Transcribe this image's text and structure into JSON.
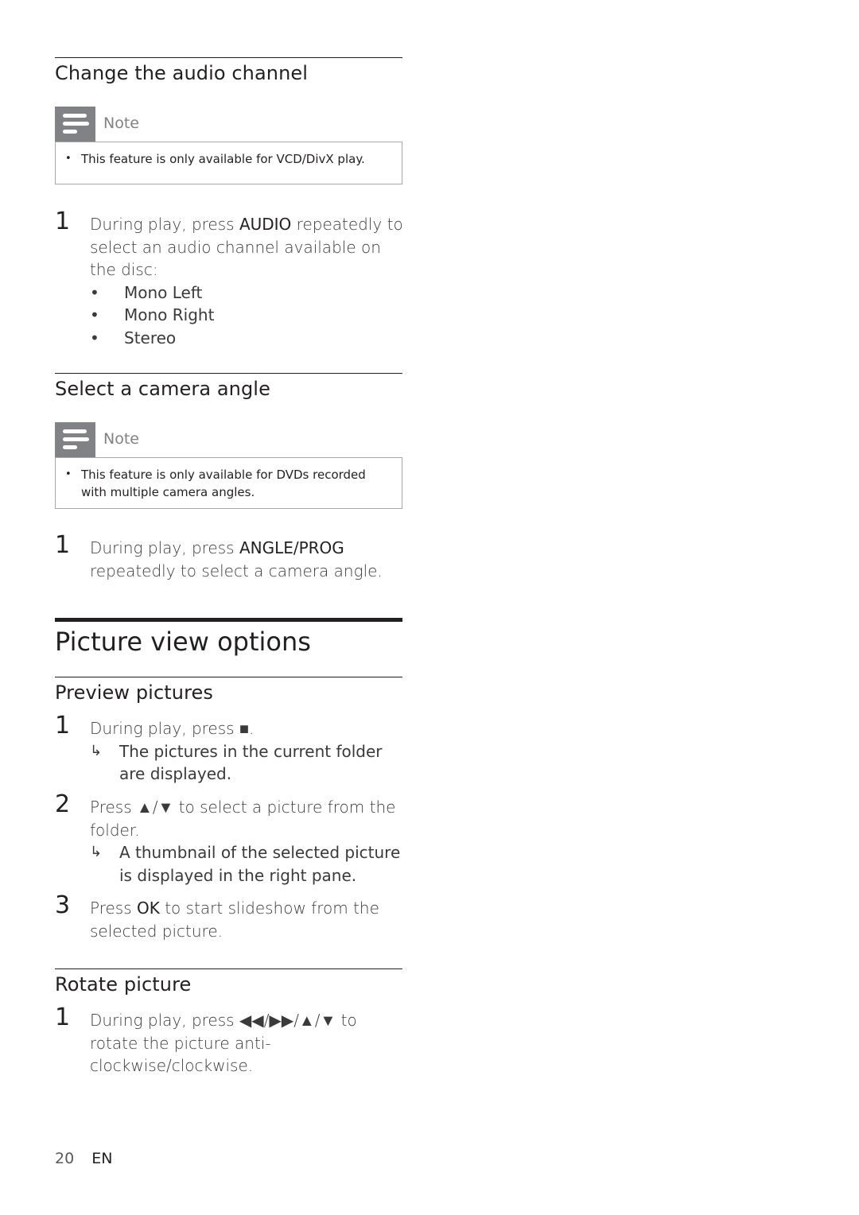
{
  "sections": {
    "audio": {
      "title": "Change the audio channel",
      "note_label": "Note",
      "note_text": "This feature is only available for VCD/DivX play.",
      "step1_num": "1",
      "step1_pre": "During play, press ",
      "step1_key": "AUDIO",
      "step1_post": " repeatedly to select an audio channel available on the disc:",
      "options": [
        "Mono Left",
        "Mono Right",
        "Stereo"
      ]
    },
    "camera": {
      "title": "Select a camera angle",
      "note_label": "Note",
      "note_text": "This feature is only available for DVDs recorded with multiple camera angles.",
      "step1_num": "1",
      "step1_pre": "During play, press ",
      "step1_key": "ANGLE/PROG",
      "step1_post": " repeatedly to select a camera angle."
    },
    "picture_view": {
      "title": "Picture view options"
    },
    "preview": {
      "title": "Preview pictures",
      "step1_num": "1",
      "step1_text": "During play, press ■.",
      "step1_result": "The pictures in the current folder are displayed.",
      "step2_num": "2",
      "step2_text": "Press ▲/▼ to select a picture from the folder.",
      "step2_result": "A thumbnail of the selected picture is displayed in the right pane.",
      "step3_num": "3",
      "step3_pre": "Press ",
      "step3_key": "OK",
      "step3_post": " to start slideshow from the selected picture."
    },
    "rotate": {
      "title": "Rotate picture",
      "step1_num": "1",
      "step1_text": "During play, press ◀◀/▶▶/▲/▼ to rotate the picture anti-clockwise/clockwise."
    }
  },
  "bullet_glyph": "•",
  "result_arrow": "↳",
  "footer": {
    "page_number": "20",
    "language": "EN"
  }
}
